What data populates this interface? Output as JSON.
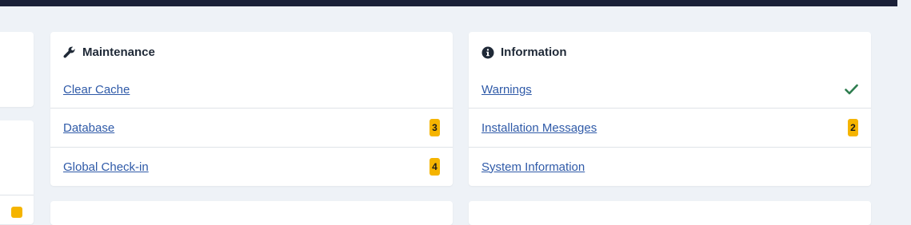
{
  "maintenance": {
    "title": "Maintenance",
    "icon": "wrench-icon",
    "items": [
      {
        "label": "Clear Cache",
        "badge": null
      },
      {
        "label": "Database",
        "badge": "3"
      },
      {
        "label": "Global Check-in",
        "badge": "4"
      }
    ]
  },
  "information": {
    "title": "Information",
    "icon": "info-circle-icon",
    "items": [
      {
        "label": "Warnings",
        "status": "check-icon"
      },
      {
        "label": "Installation Messages",
        "badge": "2"
      },
      {
        "label": "System Information",
        "badge": null
      }
    ]
  },
  "colors": {
    "topbar": "#1a2038",
    "background": "#eef2f7",
    "link": "#2f5aa8",
    "badge": "#f5b400",
    "check": "#2e7d4f"
  }
}
